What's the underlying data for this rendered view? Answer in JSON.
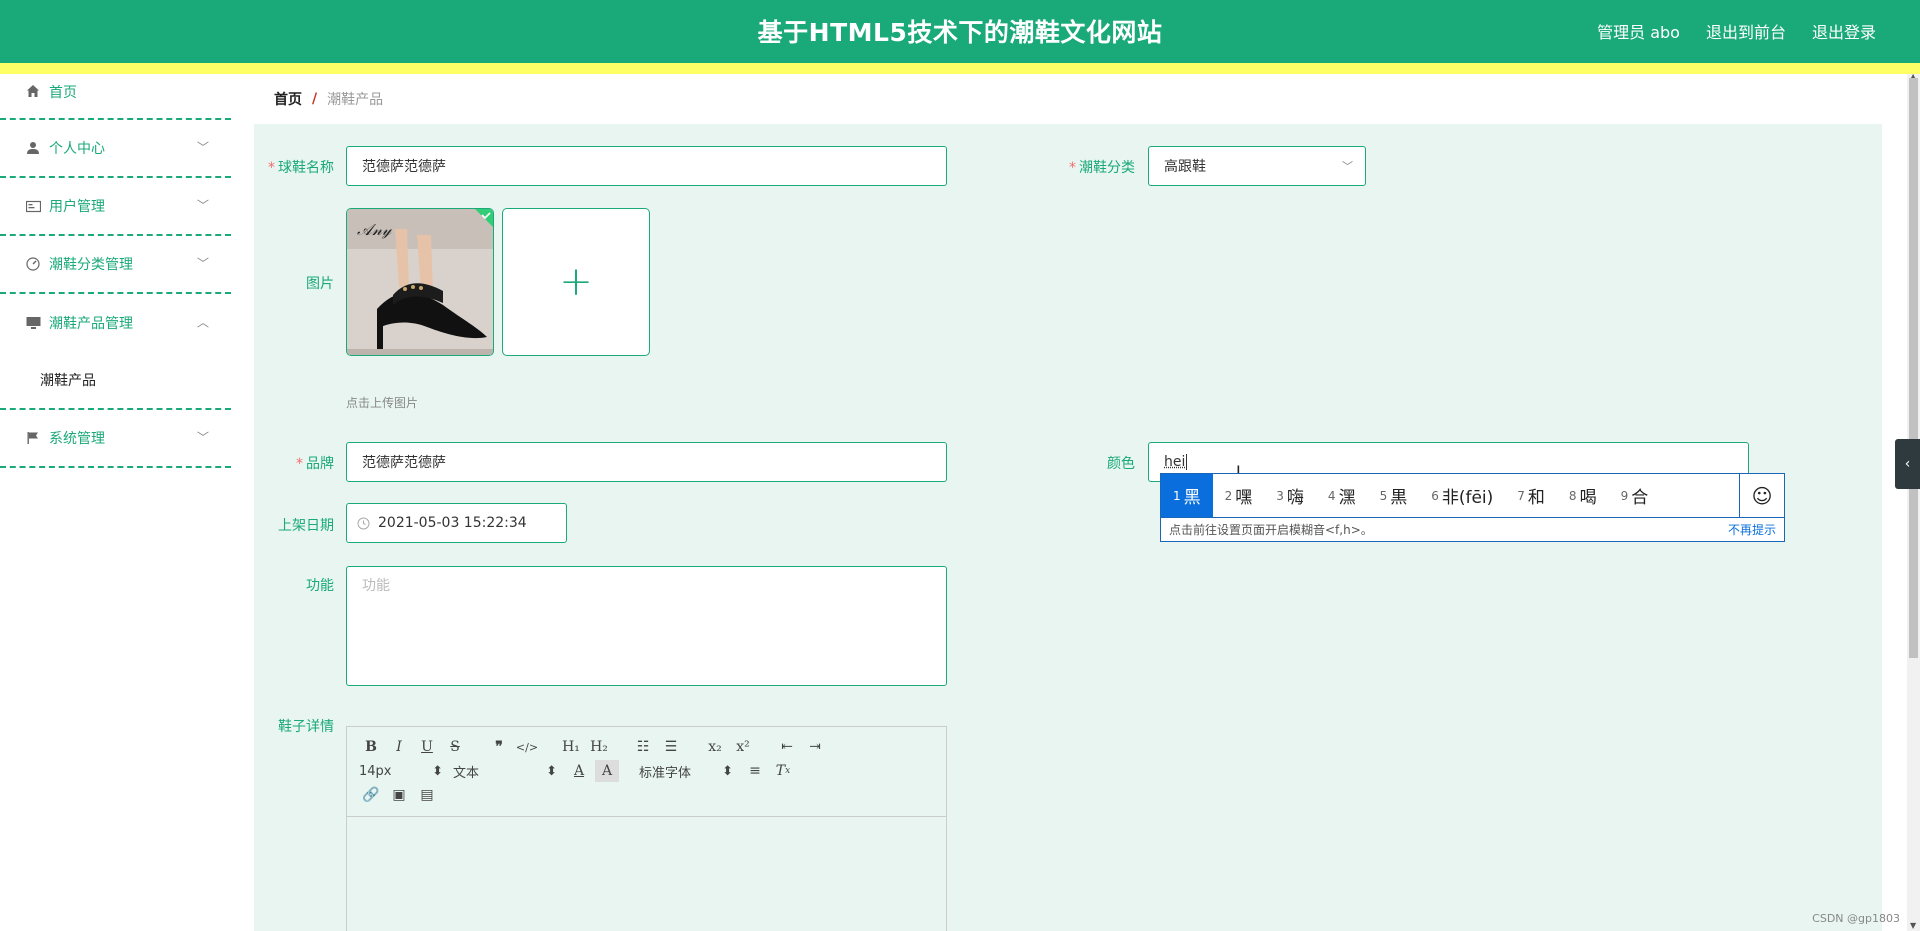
{
  "header": {
    "title": "基于HTML5技术下的潮鞋文化网站",
    "admin_label": "管理员 abo",
    "front_label": "退出到前台",
    "logout_label": "退出登录"
  },
  "sidebar": {
    "items": [
      {
        "label": "首页",
        "icon": "home-icon"
      },
      {
        "label": "个人中心",
        "icon": "user-icon"
      },
      {
        "label": "用户管理",
        "icon": "id-card-icon"
      },
      {
        "label": "潮鞋分类管理",
        "icon": "gauge-icon"
      },
      {
        "label": "潮鞋产品管理",
        "icon": "monitor-icon"
      },
      {
        "label": "系统管理",
        "icon": "flag-icon"
      }
    ],
    "submenu_label": "潮鞋产品"
  },
  "breadcrumb": {
    "home": "首页",
    "separator": "/",
    "current": "潮鞋产品"
  },
  "form": {
    "name_label": "球鞋名称",
    "name_value": "范德萨范德萨",
    "category_label": "潮鞋分类",
    "category_value": "高跟鞋",
    "image_label": "图片",
    "upload_hint": "点击上传图片",
    "brand_label": "品牌",
    "brand_value": "范德萨范德萨",
    "color_label": "颜色",
    "color_value": "hei",
    "date_label": "上架日期",
    "date_value": "2021-05-03 15:22:34",
    "function_label": "功能",
    "function_placeholder": "功能",
    "detail_label": "鞋子详情"
  },
  "editor": {
    "font_size": "14px",
    "text_type": "文本",
    "font_family": "标准字体"
  },
  "ime": {
    "candidates": [
      {
        "num": "1",
        "text": "黑"
      },
      {
        "num": "2",
        "text": "嘿"
      },
      {
        "num": "3",
        "text": "嗨"
      },
      {
        "num": "4",
        "text": "潶"
      },
      {
        "num": "5",
        "text": "黒"
      },
      {
        "num": "6",
        "text": "非(fēi)"
      },
      {
        "num": "7",
        "text": "和"
      },
      {
        "num": "8",
        "text": "喝"
      },
      {
        "num": "9",
        "text": "合"
      }
    ],
    "hint": "点击前往设置页面开启模糊音<f,h>。",
    "dismiss": "不再提示"
  },
  "watermark": "CSDN @gp1803",
  "colors": {
    "primary": "#1aa978",
    "stripe": "#ffff66",
    "background": "#e8f5f1",
    "required": "#f56c6c",
    "ime_selected": "#0a6fdc"
  }
}
